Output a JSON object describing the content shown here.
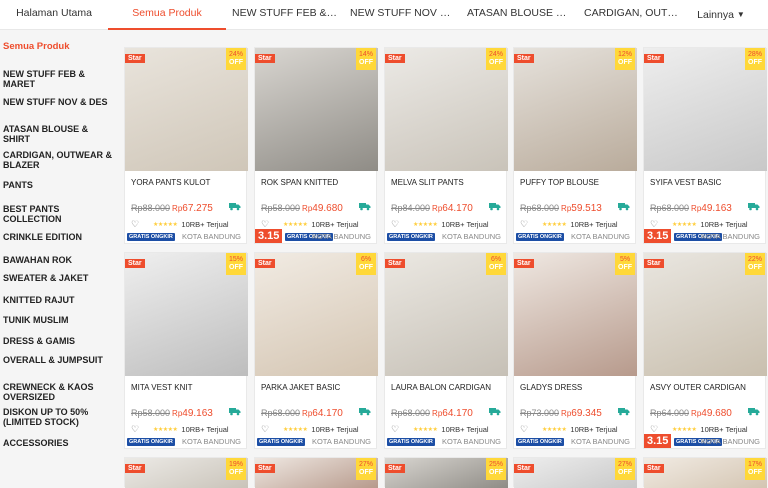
{
  "topnav": {
    "tabs": [
      "Halaman Utama",
      "Semua Produk",
      "NEW STUFF FEB & MA...",
      "NEW STUFF NOV & DES",
      "ATASAN BLOUSE & SH...",
      "CARDIGAN, OUTWEAR..."
    ],
    "more": "Lainnya",
    "active_index": 1
  },
  "sidebar": {
    "active": "Semua Produk",
    "items": [
      [
        "NEW STUFF FEB &",
        "MARET"
      ],
      [
        "NEW STUFF NOV & DES"
      ],
      [
        "ATASAN BLOUSE &",
        "SHIRT"
      ],
      [
        "CARDIGAN, OUTWEAR &",
        "BLAZER"
      ],
      [
        "PANTS"
      ],
      [
        "BEST PANTS",
        "COLLECTION"
      ],
      [
        "CRINKLE EDITION"
      ],
      [
        "BAWAHAN ROK"
      ],
      [
        "SWEATER & JAKET"
      ],
      [
        "KNITTED RAJUT"
      ],
      [
        "TUNIK MUSLIM"
      ],
      [
        "DRESS & GAMIS"
      ],
      [
        "OVERALL & JUMPSUIT"
      ],
      [
        "CREWNECK & KAOS",
        "OVERSIZED"
      ],
      [
        "DISKON UP TO 50%",
        "(LIMITED STOCK)"
      ],
      [
        "ACCESSORIES"
      ]
    ]
  },
  "badges": {
    "star": "Star",
    "off": "OFF",
    "promo": "3.15",
    "freeship": "GRATIS ONGKIR"
  },
  "products": [
    {
      "name": "YORA PANTS KULOT",
      "orig": "Rp88.000",
      "currency": "Rp",
      "price": "67.275",
      "discount": "24%",
      "sold": "10RB+ Terjual",
      "loc": "KOTA BANDUNG",
      "promo": false
    },
    {
      "name": "ROK SPAN KNITTED",
      "orig": "Rp58.000",
      "currency": "Rp",
      "price": "49.680",
      "discount": "14%",
      "sold": "10RB+ Terjual",
      "loc": "KOTA BANDUNG",
      "promo": true
    },
    {
      "name": "MELVA SLIT PANTS",
      "orig": "Rp84.000",
      "currency": "Rp",
      "price": "64.170",
      "discount": "24%",
      "sold": "10RB+ Terjual",
      "loc": "KOTA BANDUNG",
      "promo": false
    },
    {
      "name": "PUFFY TOP BLOUSE",
      "orig": "Rp68.000",
      "currency": "Rp",
      "price": "59.513",
      "discount": "12%",
      "sold": "10RB+ Terjual",
      "loc": "KOTA BANDUNG",
      "promo": false
    },
    {
      "name": "SYIFA VEST BASIC",
      "orig": "Rp68.000",
      "currency": "Rp",
      "price": "49.163",
      "discount": "28%",
      "sold": "10RB+ Terjual",
      "loc": "KOTA BANDUNG",
      "promo": true
    },
    {
      "name": "MITA VEST KNIT",
      "orig": "Rp58.000",
      "currency": "Rp",
      "price": "49.163",
      "discount": "15%",
      "sold": "10RB+ Terjual",
      "loc": "KOTA BANDUNG",
      "promo": false
    },
    {
      "name": "PARKA JAKET BASIC",
      "orig": "Rp68.000",
      "currency": "Rp",
      "price": "64.170",
      "discount": "6%",
      "sold": "10RB+ Terjual",
      "loc": "KOTA BANDUNG",
      "promo": false
    },
    {
      "name": "LAURA BALON CARDIGAN",
      "orig": "Rp68.000",
      "currency": "Rp",
      "price": "64.170",
      "discount": "6%",
      "sold": "10RB+ Terjual",
      "loc": "KOTA BANDUNG",
      "promo": false
    },
    {
      "name": "GLADYS DRESS",
      "orig": "Rp73.000",
      "currency": "Rp",
      "price": "69.345",
      "discount": "5%",
      "sold": "10RB+ Terjual",
      "loc": "KOTA BANDUNG",
      "promo": false
    },
    {
      "name": "ASVY OUTER CARDIGAN",
      "orig": "Rp64.000",
      "currency": "Rp",
      "price": "49.680",
      "discount": "22%",
      "sold": "10RB+ Terjual",
      "loc": "KOTA BANDUNG",
      "promo": true
    }
  ],
  "partial_discounts": [
    "19%",
    "27%",
    "25%",
    "27%",
    "17%"
  ],
  "colors": {
    "accent": "#ee4d2d",
    "discount_bg": "#ffd839",
    "freeship": "#1c4ea5",
    "truck": "#26aa99"
  }
}
